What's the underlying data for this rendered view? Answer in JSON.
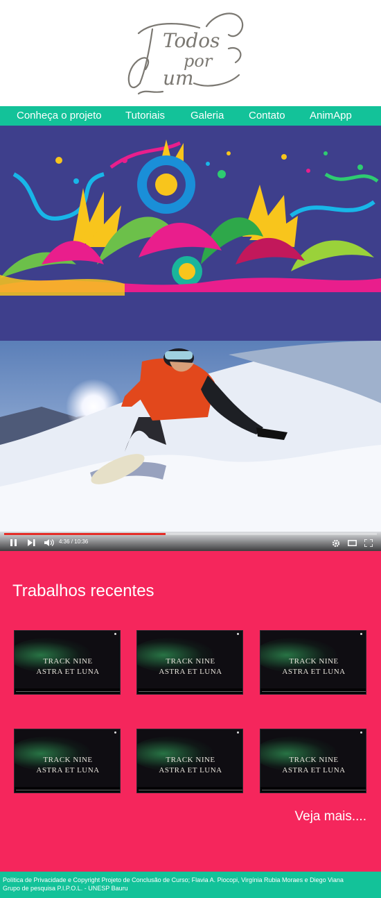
{
  "logo": {
    "line1": "Todos",
    "line2": "por",
    "line3": "um"
  },
  "nav": {
    "items": [
      {
        "label": "Conheça o projeto"
      },
      {
        "label": "Tutoriais"
      },
      {
        "label": "Galeria"
      },
      {
        "label": "Contato"
      },
      {
        "label": "AnimApp"
      }
    ]
  },
  "video": {
    "time": "4:36 / 10:36",
    "progress": 0.434
  },
  "recent": {
    "title": "Trabalhos recentes",
    "thumbs": [
      {
        "line1": "TRACK NINE",
        "line2": "ASTRA ET LUNA"
      },
      {
        "line1": "TRACK NINE",
        "line2": "ASTRA ET LUNA"
      },
      {
        "line1": "TRACK NINE",
        "line2": "ASTRA ET LUNA"
      },
      {
        "line1": "TRACK NINE",
        "line2": "ASTRA ET LUNA"
      },
      {
        "line1": "TRACK NINE",
        "line2": "ASTRA ET LUNA"
      },
      {
        "line1": "TRACK NINE",
        "line2": "ASTRA ET LUNA"
      }
    ],
    "more_label": "Veja mais...."
  },
  "footer": {
    "line1": "Política de Privacidade e Copyright  Projeto de Conclusão de Curso; Flavia A. Piocopi, Virgínia Rubia Moraes e Diego Viana",
    "line2": "Grupo de pesquisa P.I.P.O.L. - UNESP Bauru"
  },
  "colors": {
    "nav": "#13c299",
    "recent_bg": "#f5265c",
    "banner_bg": "#3e3f8c",
    "progress": "#e52d27"
  },
  "icons": [
    "pause-icon",
    "skip-next-icon",
    "volume-icon",
    "settings-icon",
    "theater-mode-icon",
    "fullscreen-icon"
  ]
}
